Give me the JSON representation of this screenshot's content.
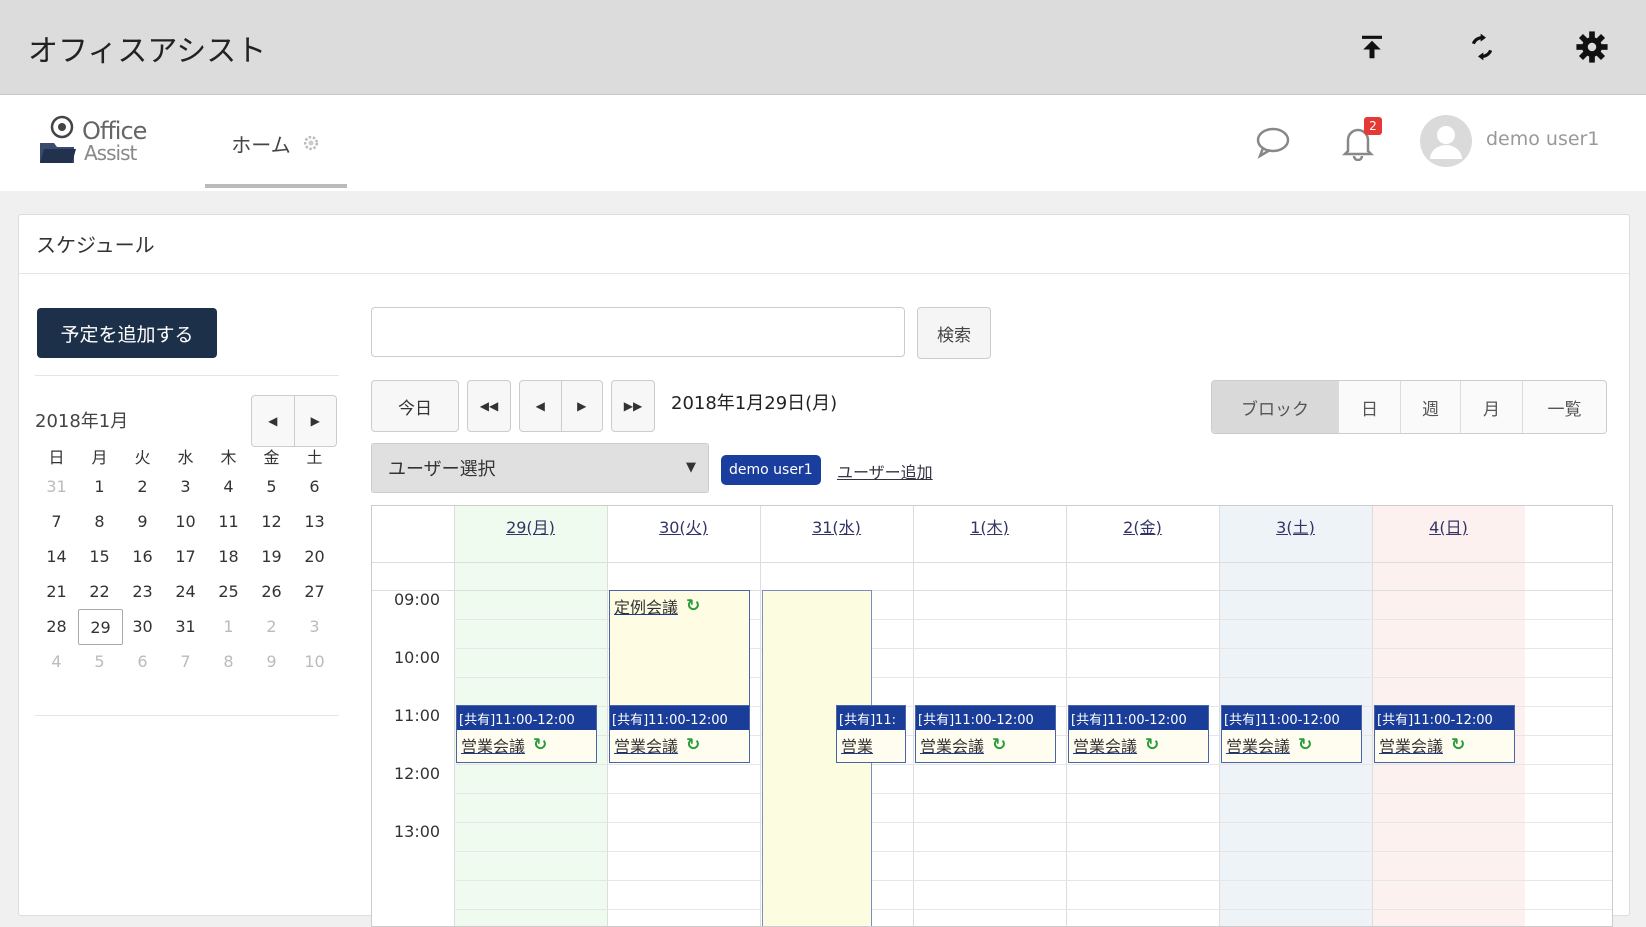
{
  "app": {
    "title": "オフィスアシスト",
    "toolbar_icons": [
      "upload-icon",
      "sync-icon",
      "settings-icon"
    ]
  },
  "header": {
    "logo_line1": "Office",
    "logo_line2": "Assist",
    "tab_home": "ホーム",
    "notification_count": "2",
    "user_name": "demo user1"
  },
  "panel": {
    "title": "スケジュール",
    "add_button": "予定を追加する"
  },
  "mini_calendar": {
    "month_label": "2018年1月",
    "weekdays": [
      "日",
      "月",
      "火",
      "水",
      "木",
      "金",
      "土"
    ],
    "weeks": [
      [
        "31",
        "1",
        "2",
        "3",
        "4",
        "5",
        "6"
      ],
      [
        "7",
        "8",
        "9",
        "10",
        "11",
        "12",
        "13"
      ],
      [
        "14",
        "15",
        "16",
        "17",
        "18",
        "19",
        "20"
      ],
      [
        "21",
        "22",
        "23",
        "24",
        "25",
        "26",
        "27"
      ],
      [
        "28",
        "29",
        "30",
        "31",
        "1",
        "2",
        "3"
      ],
      [
        "4",
        "5",
        "6",
        "7",
        "8",
        "9",
        "10"
      ]
    ],
    "today": "29"
  },
  "search": {
    "placeholder": "",
    "button": "検索"
  },
  "nav": {
    "today": "今日",
    "date_label": "2018年1月29日(月)"
  },
  "views": [
    "ブロック",
    "日",
    "週",
    "月",
    "一覧"
  ],
  "active_view": "ブロック",
  "user_filter": {
    "select_label": "ユーザー選択",
    "selected_user": "demo user1",
    "add_user": "ユーザー追加"
  },
  "colors": {
    "monday_bg": "#eefbee",
    "saturday_bg": "#eef3f8",
    "sunday_bg": "#fcf1ee",
    "event_header": "#1a3d99",
    "event_body": "#fffdf0",
    "recurring_icon": "#2a9d3a"
  },
  "schedule": {
    "days": [
      "29(月)",
      "30(火)",
      "31(水)",
      "1(木)",
      "2(金)",
      "3(土)",
      "4(日)"
    ],
    "times": [
      "09:00",
      "10:00",
      "11:00",
      "12:00",
      "13:00"
    ],
    "events": [
      {
        "day": 0,
        "header": "[共有]11:00-12:00",
        "title": "営業会議",
        "recurring": true
      },
      {
        "day": 1,
        "header": "",
        "title": "定例会議",
        "recurring": true
      },
      {
        "day": 1,
        "header": "[共有]11:00-12:00",
        "title": "営業会議",
        "recurring": true
      },
      {
        "day": 2,
        "header": "[共有]11:",
        "title": "営業",
        "recurring": false
      },
      {
        "day": 3,
        "header": "[共有]11:00-12:00",
        "title": "営業会議",
        "recurring": true
      },
      {
        "day": 4,
        "header": "[共有]11:00-12:00",
        "title": "営業会議",
        "recurring": true
      },
      {
        "day": 5,
        "header": "[共有]11:00-12:00",
        "title": "営業会議",
        "recurring": true
      },
      {
        "day": 6,
        "header": "[共有]11:00-12:00",
        "title": "営業会議",
        "recurring": true
      }
    ]
  }
}
